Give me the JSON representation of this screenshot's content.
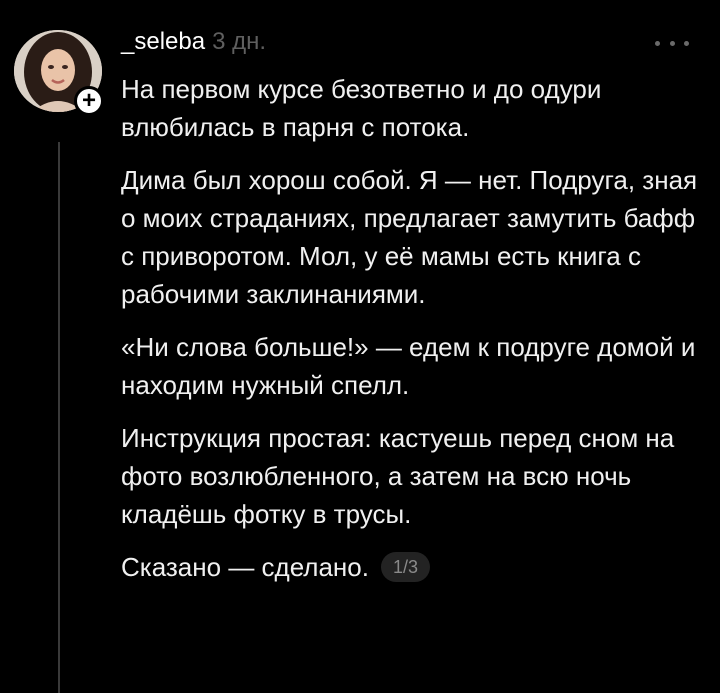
{
  "post": {
    "username": "_seleba",
    "timestamp": "3 дн.",
    "paragraphs": [
      "На первом курсе безответно и до одури влюбилась в парня с потока.",
      "Дима был хорош собой. Я — нет. Подруга, зная о моих страданиях, предлагает замутить бафф с приворотом. Мол, у её мамы есть книга с рабочими заклинаниями.",
      "«Ни слова больше!» — едем к подруге домой и находим нужный спелл.",
      "Инструкция простая: кастуешь перед сном на фото возлюбленного, а затем на всю ночь кладёшь фотку в трусы."
    ],
    "last_line": "Сказано — сделано.",
    "page_indicator": "1/3"
  },
  "icons": {
    "follow": "plus-icon",
    "more": "more-dots-icon"
  },
  "colors": {
    "background": "#000000",
    "text": "#f0f0f0",
    "muted": "#5f5f5f",
    "badge_bg": "#232323"
  }
}
